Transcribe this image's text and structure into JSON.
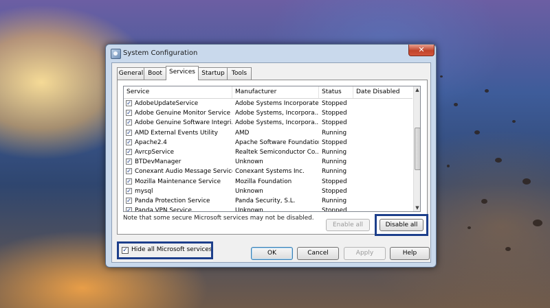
{
  "window": {
    "title": "System Configuration",
    "close_label": "✕"
  },
  "tabs": [
    {
      "label": "General"
    },
    {
      "label": "Boot"
    },
    {
      "label": "Services"
    },
    {
      "label": "Startup"
    },
    {
      "label": "Tools"
    }
  ],
  "active_tab": "Services",
  "services": {
    "columns": [
      "Service",
      "Manufacturer",
      "Status",
      "Date Disabled"
    ],
    "rows": [
      {
        "checked": true,
        "service": "AdobeUpdateService",
        "manufacturer": "Adobe Systems Incorporated",
        "status": "Stopped",
        "date_disabled": ""
      },
      {
        "checked": true,
        "service": "Adobe Genuine Monitor Service",
        "manufacturer": "Adobe Systems, Incorpora...",
        "status": "Stopped",
        "date_disabled": ""
      },
      {
        "checked": true,
        "service": "Adobe Genuine Software Integri...",
        "manufacturer": "Adobe Systems, Incorpora...",
        "status": "Stopped",
        "date_disabled": ""
      },
      {
        "checked": true,
        "service": "AMD External Events Utility",
        "manufacturer": "AMD",
        "status": "Running",
        "date_disabled": ""
      },
      {
        "checked": true,
        "service": "Apache2.4",
        "manufacturer": "Apache Software Foundation",
        "status": "Stopped",
        "date_disabled": ""
      },
      {
        "checked": true,
        "service": "AvrcpService",
        "manufacturer": "Realtek Semiconductor Co...",
        "status": "Running",
        "date_disabled": ""
      },
      {
        "checked": true,
        "service": "BTDevManager",
        "manufacturer": "Unknown",
        "status": "Running",
        "date_disabled": ""
      },
      {
        "checked": true,
        "service": "Conexant Audio Message Service",
        "manufacturer": "Conexant Systems Inc.",
        "status": "Running",
        "date_disabled": ""
      },
      {
        "checked": true,
        "service": "Mozilla Maintenance Service",
        "manufacturer": "Mozilla Foundation",
        "status": "Stopped",
        "date_disabled": ""
      },
      {
        "checked": true,
        "service": "mysql",
        "manufacturer": "Unknown",
        "status": "Stopped",
        "date_disabled": ""
      },
      {
        "checked": true,
        "service": "Panda Protection Service",
        "manufacturer": "Panda Security, S.L.",
        "status": "Running",
        "date_disabled": ""
      },
      {
        "checked": true,
        "service": "Panda VPN Service",
        "manufacturer": "Unknown",
        "status": "Stopped",
        "date_disabled": ""
      }
    ]
  },
  "note": "Note that some secure Microsoft services may not be disabled.",
  "enable_all_label": "Enable all",
  "disable_all_label": "Disable all",
  "hide_ms": {
    "checked": true,
    "label": "Hide all Microsoft services"
  },
  "buttons": {
    "ok": "OK",
    "cancel": "Cancel",
    "apply": "Apply",
    "help": "Help"
  },
  "colors": {
    "highlight": "#1d3f8b",
    "title_bar": "#c9d9ec",
    "close_button": "#c1442b"
  },
  "icons": {
    "check": "✓",
    "scroll_up": "▲",
    "scroll_down": "▼"
  }
}
